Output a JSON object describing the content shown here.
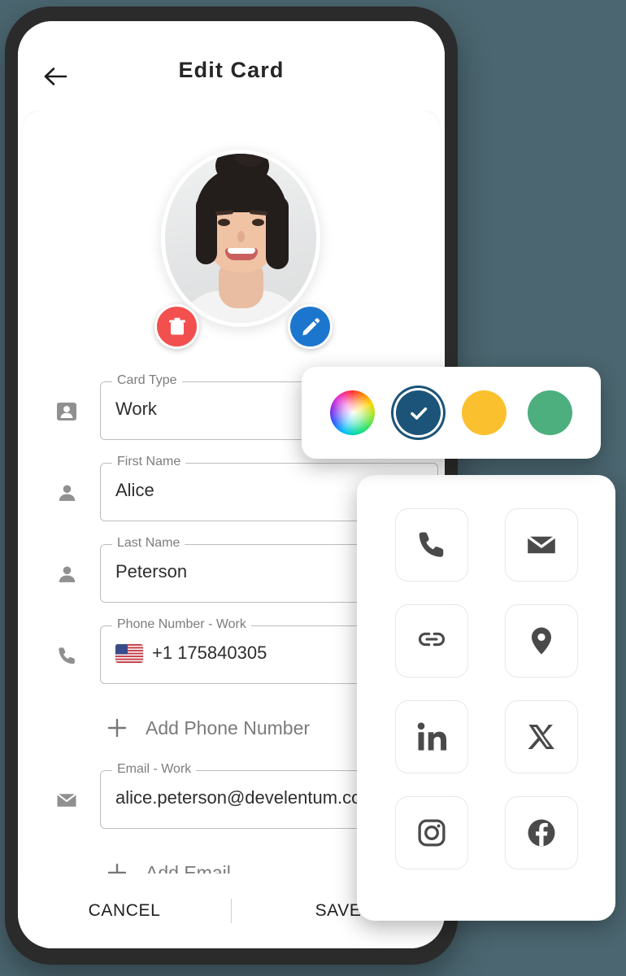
{
  "background_color": "#4b6670",
  "app": {
    "title": "Edit Card",
    "back_icon": "arrow-left-icon"
  },
  "avatar": {
    "delete_icon": "trash-icon",
    "edit_icon": "pencil-icon",
    "delete_color": "#f2504f",
    "edit_color": "#1d76ce"
  },
  "form": {
    "fields": [
      {
        "label": "Card Type",
        "value": "Work",
        "icon": "contact-card-icon"
      },
      {
        "label": "First Name",
        "value": "Alice",
        "icon": "person-icon"
      },
      {
        "label": "Last Name",
        "value": "Peterson",
        "icon": "person-icon"
      },
      {
        "label": "Phone Number - Work",
        "value": "+1  175840305",
        "icon": "phone-icon",
        "flag": "us-flag"
      },
      {
        "label": "Email - Work",
        "value": "alice.peterson@develentum.com",
        "icon": "envelope-icon"
      }
    ],
    "add_phone_label": "Add Phone Number",
    "add_email_label": "Add Email",
    "add_icon": "plus-icon"
  },
  "bottom_bar": {
    "cancel_label": "CANCEL",
    "save_label": "SAVE"
  },
  "color_picker": {
    "swatches": [
      {
        "name": "custom-color-wheel",
        "color": "rainbow",
        "selected": false
      },
      {
        "name": "dark-blue",
        "color": "#1b5478",
        "selected": true
      },
      {
        "name": "amber",
        "color": "#fbc02d",
        "selected": false
      },
      {
        "name": "green",
        "color": "#4caf7d",
        "selected": false
      }
    ],
    "selected_check_icon": "check-icon"
  },
  "icon_sheet": {
    "tiles": [
      {
        "name": "phone-icon"
      },
      {
        "name": "email-icon"
      },
      {
        "name": "link-icon"
      },
      {
        "name": "location-pin-icon"
      },
      {
        "name": "linkedin-icon"
      },
      {
        "name": "x-twitter-icon"
      },
      {
        "name": "instagram-icon"
      },
      {
        "name": "facebook-icon"
      }
    ]
  }
}
